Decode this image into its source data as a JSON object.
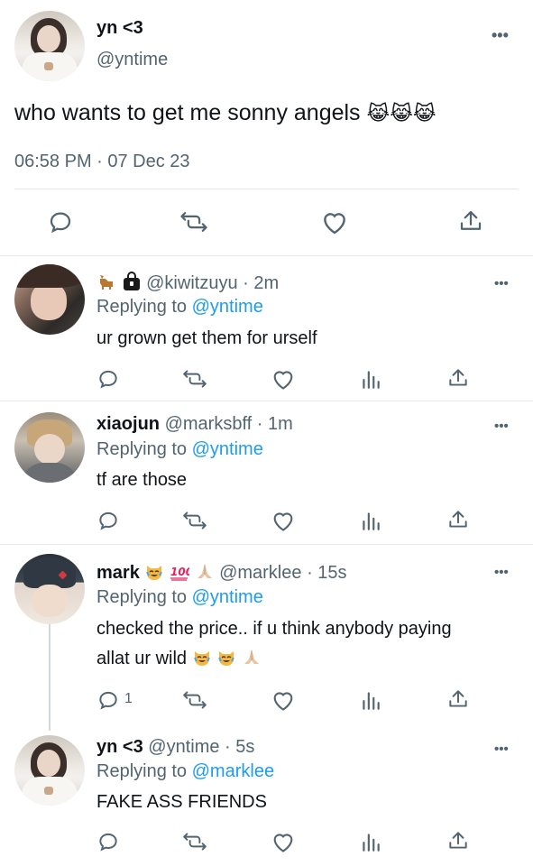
{
  "main_tweet": {
    "name": "yn <3",
    "handle": "@yntime",
    "text": "who wants to get me sonny angels",
    "emojis": "😹😹😹",
    "timestamp": "06:58 PM · 07 Dec 23",
    "more": "•••"
  },
  "replies": [
    {
      "display_name": "",
      "name_emojis": [
        "deer-emoji",
        "lock-bag-emoji"
      ],
      "handle": "@kiwitzuyu",
      "time": "· 2m",
      "replying_label": "Replying to",
      "replying_to": "@yntime",
      "text": "ur grown get them for urself",
      "reply_count": ""
    },
    {
      "display_name": "xiaojun",
      "handle": "@marksbff",
      "time": "· 1m",
      "replying_label": "Replying to",
      "replying_to": "@yntime",
      "text": "tf are those",
      "reply_count": ""
    },
    {
      "display_name": "mark",
      "name_emojis": [
        "joy-cat-emoji",
        "hundred-emoji",
        "pray-emoji"
      ],
      "handle": "@marklee",
      "time": "· 15s",
      "replying_label": "Replying to",
      "replying_to": "@yntime",
      "text_line1": "checked the price.. if u think anybody paying",
      "text_line2": "allat ur wild",
      "reply_count": "1"
    },
    {
      "display_name": "yn <3",
      "handle": "@yntime",
      "time": "· 5s",
      "replying_label": "Replying to",
      "replying_to": "@marklee",
      "text": "FAKE ASS FRIENDS",
      "reply_count": ""
    }
  ],
  "colors": {
    "text": "#0f1419",
    "secondary": "#536471",
    "link": "#1d9bf0",
    "divider": "#e6e9eb"
  },
  "icons": [
    "reply-icon",
    "retweet-icon",
    "like-icon",
    "views-icon",
    "share-icon",
    "more-icon"
  ]
}
